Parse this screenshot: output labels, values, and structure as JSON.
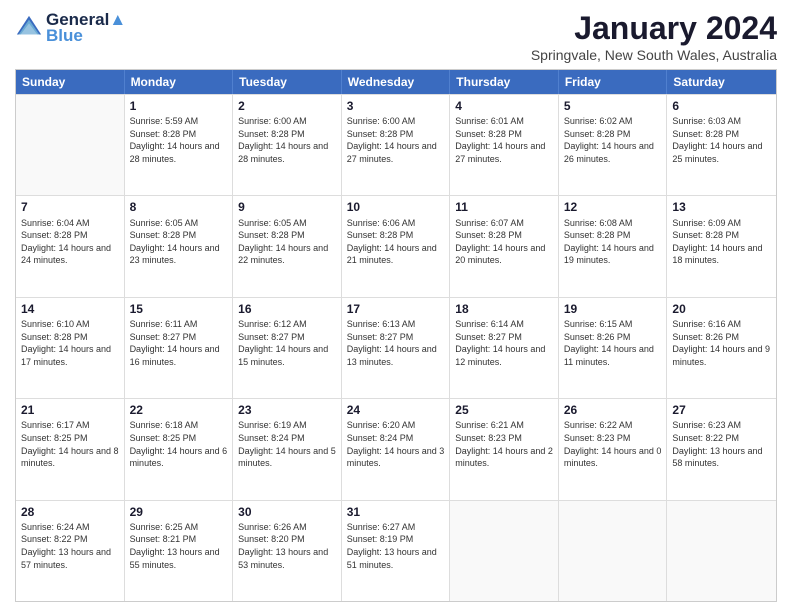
{
  "header": {
    "logo_line1": "General",
    "logo_line2": "Blue",
    "month_title": "January 2024",
    "location": "Springvale, New South Wales, Australia"
  },
  "weekdays": [
    "Sunday",
    "Monday",
    "Tuesday",
    "Wednesday",
    "Thursday",
    "Friday",
    "Saturday"
  ],
  "rows": [
    [
      {
        "day": "",
        "sunrise": "",
        "sunset": "",
        "daylight": ""
      },
      {
        "day": "1",
        "sunrise": "Sunrise: 5:59 AM",
        "sunset": "Sunset: 8:28 PM",
        "daylight": "Daylight: 14 hours and 28 minutes."
      },
      {
        "day": "2",
        "sunrise": "Sunrise: 6:00 AM",
        "sunset": "Sunset: 8:28 PM",
        "daylight": "Daylight: 14 hours and 28 minutes."
      },
      {
        "day": "3",
        "sunrise": "Sunrise: 6:00 AM",
        "sunset": "Sunset: 8:28 PM",
        "daylight": "Daylight: 14 hours and 27 minutes."
      },
      {
        "day": "4",
        "sunrise": "Sunrise: 6:01 AM",
        "sunset": "Sunset: 8:28 PM",
        "daylight": "Daylight: 14 hours and 27 minutes."
      },
      {
        "day": "5",
        "sunrise": "Sunrise: 6:02 AM",
        "sunset": "Sunset: 8:28 PM",
        "daylight": "Daylight: 14 hours and 26 minutes."
      },
      {
        "day": "6",
        "sunrise": "Sunrise: 6:03 AM",
        "sunset": "Sunset: 8:28 PM",
        "daylight": "Daylight: 14 hours and 25 minutes."
      }
    ],
    [
      {
        "day": "7",
        "sunrise": "Sunrise: 6:04 AM",
        "sunset": "Sunset: 8:28 PM",
        "daylight": "Daylight: 14 hours and 24 minutes."
      },
      {
        "day": "8",
        "sunrise": "Sunrise: 6:05 AM",
        "sunset": "Sunset: 8:28 PM",
        "daylight": "Daylight: 14 hours and 23 minutes."
      },
      {
        "day": "9",
        "sunrise": "Sunrise: 6:05 AM",
        "sunset": "Sunset: 8:28 PM",
        "daylight": "Daylight: 14 hours and 22 minutes."
      },
      {
        "day": "10",
        "sunrise": "Sunrise: 6:06 AM",
        "sunset": "Sunset: 8:28 PM",
        "daylight": "Daylight: 14 hours and 21 minutes."
      },
      {
        "day": "11",
        "sunrise": "Sunrise: 6:07 AM",
        "sunset": "Sunset: 8:28 PM",
        "daylight": "Daylight: 14 hours and 20 minutes."
      },
      {
        "day": "12",
        "sunrise": "Sunrise: 6:08 AM",
        "sunset": "Sunset: 8:28 PM",
        "daylight": "Daylight: 14 hours and 19 minutes."
      },
      {
        "day": "13",
        "sunrise": "Sunrise: 6:09 AM",
        "sunset": "Sunset: 8:28 PM",
        "daylight": "Daylight: 14 hours and 18 minutes."
      }
    ],
    [
      {
        "day": "14",
        "sunrise": "Sunrise: 6:10 AM",
        "sunset": "Sunset: 8:28 PM",
        "daylight": "Daylight: 14 hours and 17 minutes."
      },
      {
        "day": "15",
        "sunrise": "Sunrise: 6:11 AM",
        "sunset": "Sunset: 8:27 PM",
        "daylight": "Daylight: 14 hours and 16 minutes."
      },
      {
        "day": "16",
        "sunrise": "Sunrise: 6:12 AM",
        "sunset": "Sunset: 8:27 PM",
        "daylight": "Daylight: 14 hours and 15 minutes."
      },
      {
        "day": "17",
        "sunrise": "Sunrise: 6:13 AM",
        "sunset": "Sunset: 8:27 PM",
        "daylight": "Daylight: 14 hours and 13 minutes."
      },
      {
        "day": "18",
        "sunrise": "Sunrise: 6:14 AM",
        "sunset": "Sunset: 8:27 PM",
        "daylight": "Daylight: 14 hours and 12 minutes."
      },
      {
        "day": "19",
        "sunrise": "Sunrise: 6:15 AM",
        "sunset": "Sunset: 8:26 PM",
        "daylight": "Daylight: 14 hours and 11 minutes."
      },
      {
        "day": "20",
        "sunrise": "Sunrise: 6:16 AM",
        "sunset": "Sunset: 8:26 PM",
        "daylight": "Daylight: 14 hours and 9 minutes."
      }
    ],
    [
      {
        "day": "21",
        "sunrise": "Sunrise: 6:17 AM",
        "sunset": "Sunset: 8:25 PM",
        "daylight": "Daylight: 14 hours and 8 minutes."
      },
      {
        "day": "22",
        "sunrise": "Sunrise: 6:18 AM",
        "sunset": "Sunset: 8:25 PM",
        "daylight": "Daylight: 14 hours and 6 minutes."
      },
      {
        "day": "23",
        "sunrise": "Sunrise: 6:19 AM",
        "sunset": "Sunset: 8:24 PM",
        "daylight": "Daylight: 14 hours and 5 minutes."
      },
      {
        "day": "24",
        "sunrise": "Sunrise: 6:20 AM",
        "sunset": "Sunset: 8:24 PM",
        "daylight": "Daylight: 14 hours and 3 minutes."
      },
      {
        "day": "25",
        "sunrise": "Sunrise: 6:21 AM",
        "sunset": "Sunset: 8:23 PM",
        "daylight": "Daylight: 14 hours and 2 minutes."
      },
      {
        "day": "26",
        "sunrise": "Sunrise: 6:22 AM",
        "sunset": "Sunset: 8:23 PM",
        "daylight": "Daylight: 14 hours and 0 minutes."
      },
      {
        "day": "27",
        "sunrise": "Sunrise: 6:23 AM",
        "sunset": "Sunset: 8:22 PM",
        "daylight": "Daylight: 13 hours and 58 minutes."
      }
    ],
    [
      {
        "day": "28",
        "sunrise": "Sunrise: 6:24 AM",
        "sunset": "Sunset: 8:22 PM",
        "daylight": "Daylight: 13 hours and 57 minutes."
      },
      {
        "day": "29",
        "sunrise": "Sunrise: 6:25 AM",
        "sunset": "Sunset: 8:21 PM",
        "daylight": "Daylight: 13 hours and 55 minutes."
      },
      {
        "day": "30",
        "sunrise": "Sunrise: 6:26 AM",
        "sunset": "Sunset: 8:20 PM",
        "daylight": "Daylight: 13 hours and 53 minutes."
      },
      {
        "day": "31",
        "sunrise": "Sunrise: 6:27 AM",
        "sunset": "Sunset: 8:19 PM",
        "daylight": "Daylight: 13 hours and 51 minutes."
      },
      {
        "day": "",
        "sunrise": "",
        "sunset": "",
        "daylight": ""
      },
      {
        "day": "",
        "sunrise": "",
        "sunset": "",
        "daylight": ""
      },
      {
        "day": "",
        "sunrise": "",
        "sunset": "",
        "daylight": ""
      }
    ]
  ]
}
